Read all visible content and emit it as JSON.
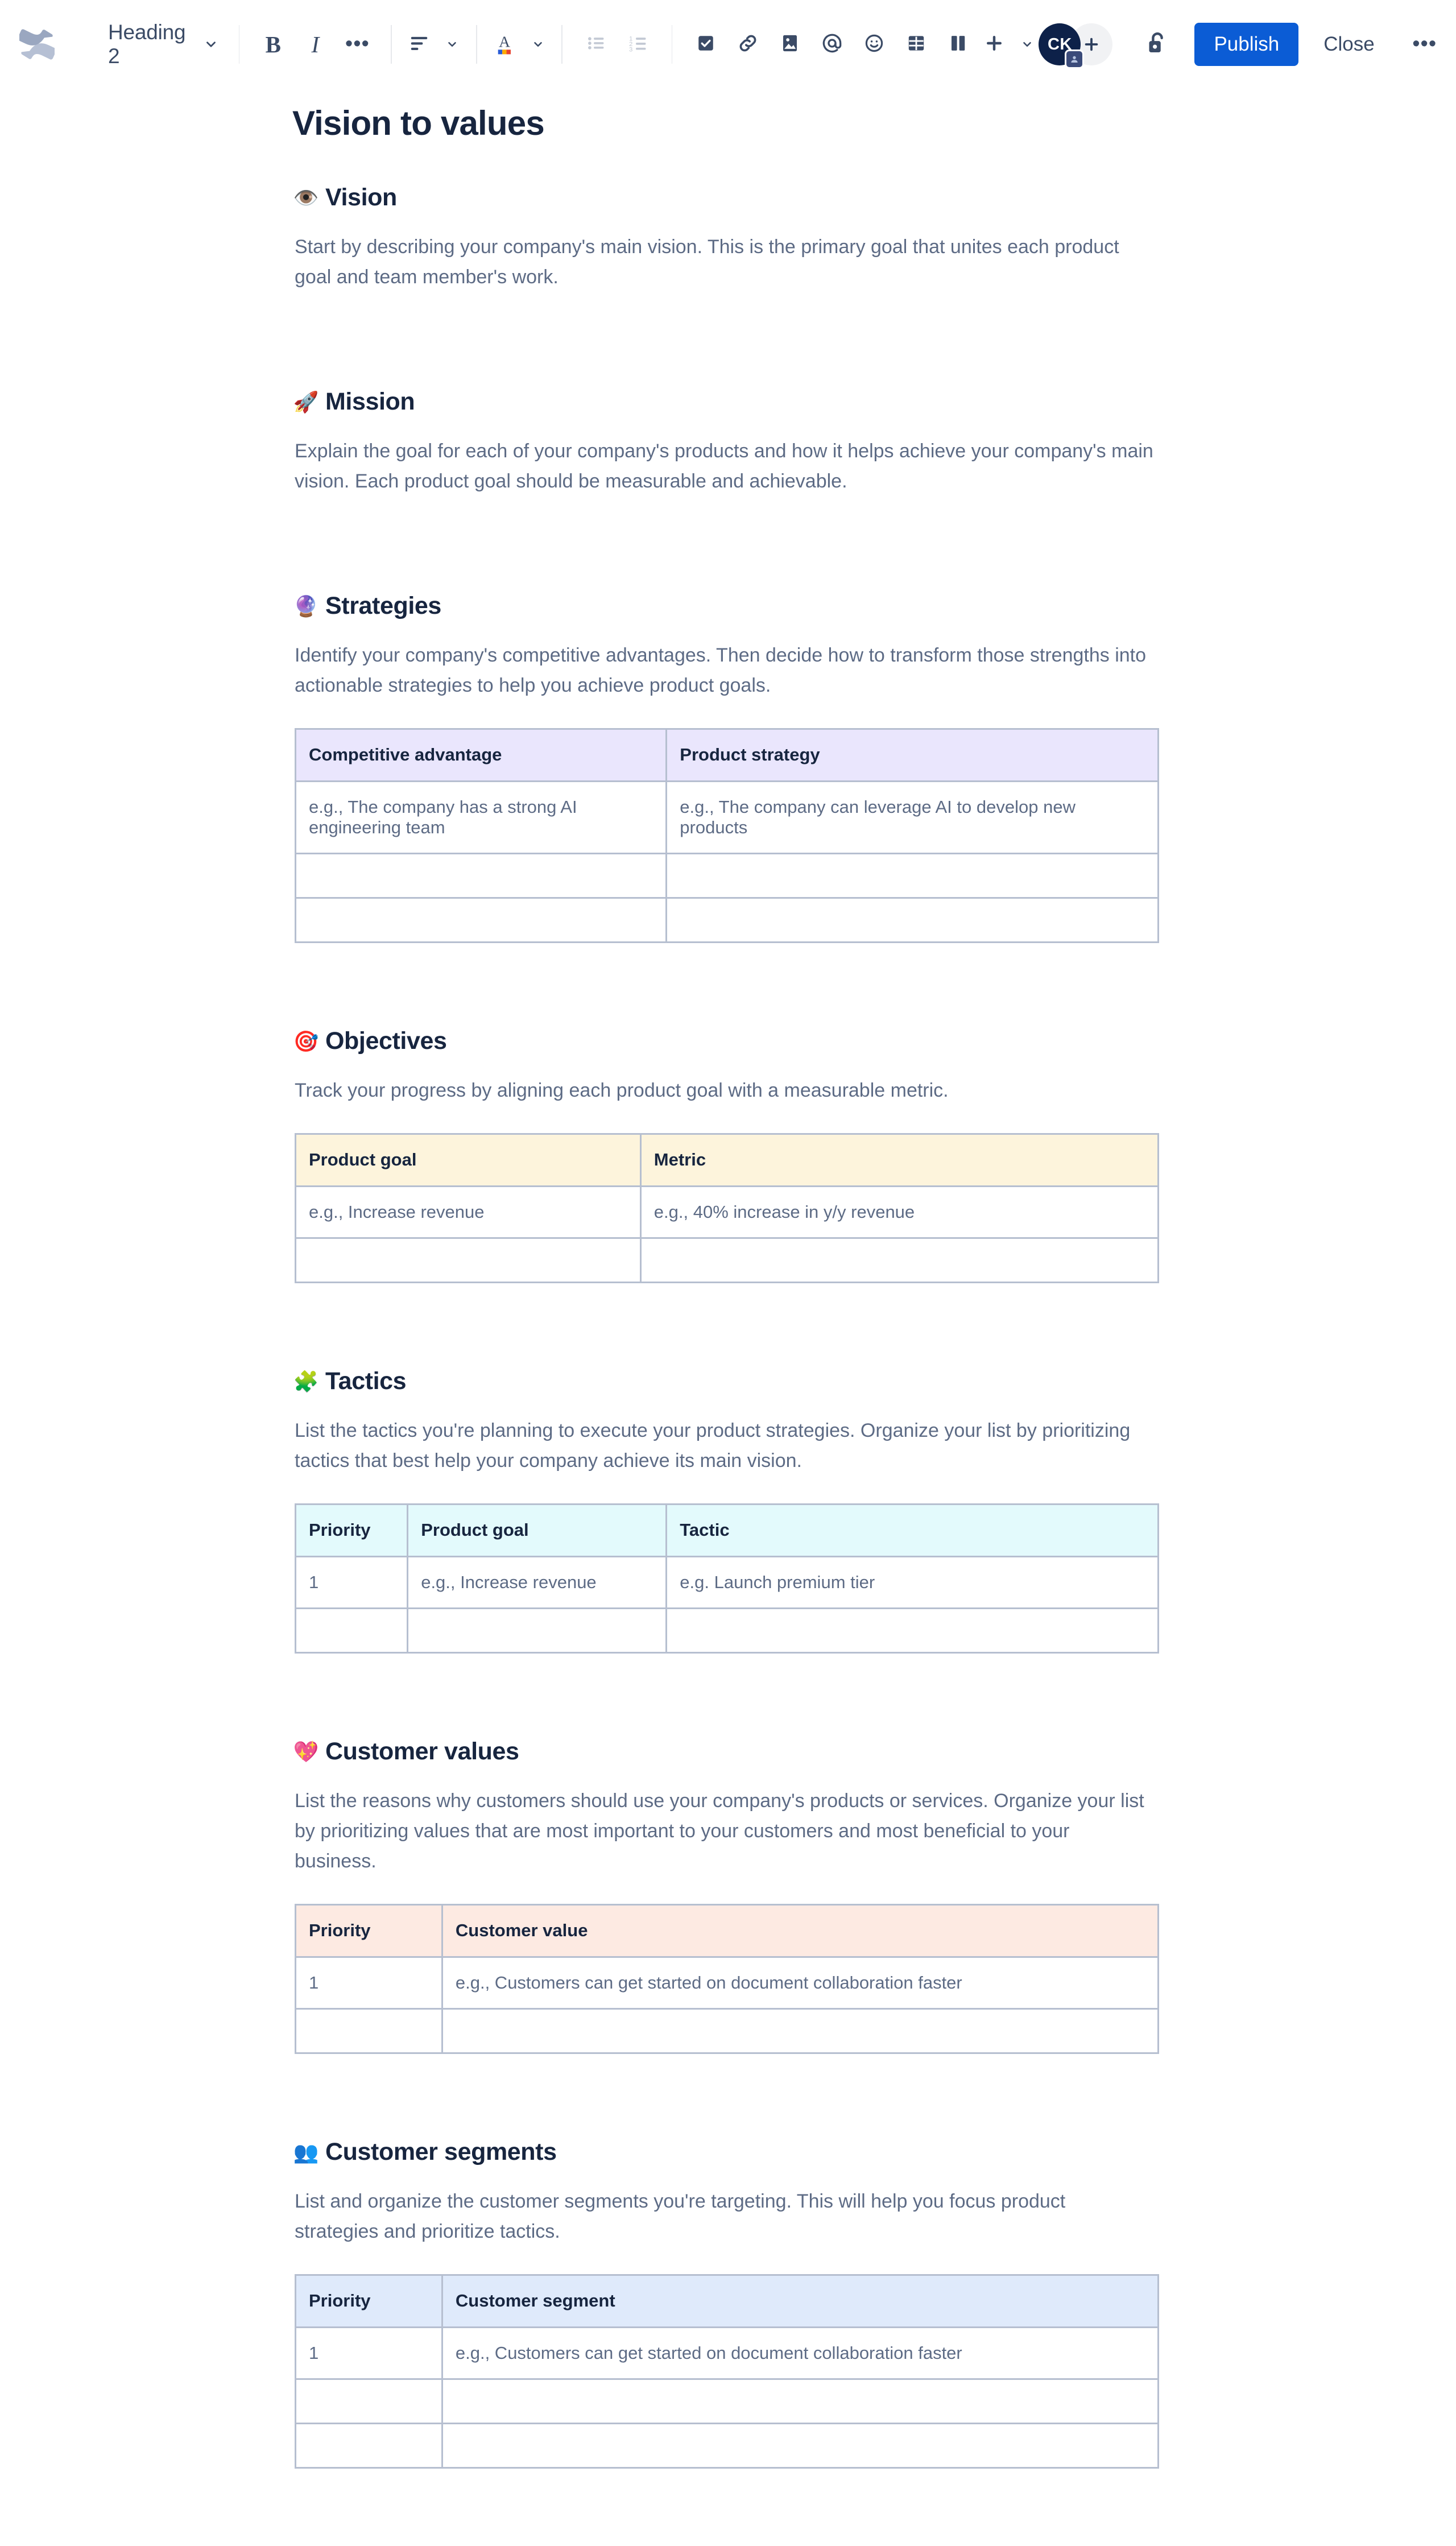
{
  "toolbar": {
    "logo_icon": "confluence-logo-icon",
    "style_select": {
      "label": "Heading 2",
      "icon": "chevron-down-icon"
    },
    "buttons": [
      {
        "name": "bold-button",
        "label": "B",
        "icon": "bold-icon"
      },
      {
        "name": "italic-button",
        "label": "I",
        "icon": "italic-icon"
      },
      {
        "name": "more-text-formatting-button",
        "label": "•••",
        "icon": "ellipsis-icon"
      },
      {
        "name": "text-alignment-button",
        "icon": "align-left-icon"
      },
      {
        "name": "text-color-button",
        "icon": "text-color-icon"
      },
      {
        "name": "bullet-list-button",
        "icon": "bullet-list-icon"
      },
      {
        "name": "numbered-list-button",
        "icon": "numbered-list-icon"
      },
      {
        "name": "action-item-button",
        "icon": "checkbox-icon"
      },
      {
        "name": "link-button",
        "icon": "link-icon"
      },
      {
        "name": "image-button",
        "icon": "image-icon"
      },
      {
        "name": "mention-button",
        "icon": "mention-at-icon"
      },
      {
        "name": "emoji-button",
        "icon": "emoji-smiley-icon"
      },
      {
        "name": "table-button",
        "icon": "table-icon"
      },
      {
        "name": "layout-button",
        "icon": "columns-layout-icon"
      },
      {
        "name": "insert-more-button",
        "icon": "plus-icon"
      }
    ],
    "avatar": {
      "initials": "CK",
      "badge_icon": "presence-badge-icon"
    },
    "add_people_label": "+",
    "lock_icon": "unlock-icon",
    "publish_label": "Publish",
    "close_label": "Close",
    "more_label": "•••"
  },
  "document": {
    "title": "Vision to values",
    "sections": [
      {
        "emoji": "👁️",
        "emoji_name": "eye-emoji",
        "heading": "Vision",
        "body": "Start by describing your company's main vision. This is the primary goal that unites each product goal and team member's work.",
        "table": null
      },
      {
        "emoji": "🚀",
        "emoji_name": "rocket-emoji",
        "heading": "Mission",
        "body": "Explain the goal for each of your company's products and how it helps achieve your company's main vision. Each product goal should be measurable and achievable.",
        "table": null
      },
      {
        "emoji": "🔮",
        "emoji_name": "crystal-ball-emoji",
        "heading": "Strategies",
        "body": "Identify your company's competitive advantages. Then decide how to transform those strengths into actionable strategies to help you achieve product goals.",
        "table": {
          "header_bg": "#eae6fd",
          "columns": [
            {
              "label": "Competitive advantage",
              "width": "43%"
            },
            {
              "label": "Product strategy",
              "width": "57%"
            }
          ],
          "rows": [
            [
              "e.g., The company has a strong AI engineering team",
              "e.g., The company can leverage AI to develop new products"
            ],
            [
              "",
              ""
            ],
            [
              "",
              ""
            ]
          ]
        }
      },
      {
        "emoji": "🎯",
        "emoji_name": "direct-hit-target-emoji",
        "heading": "Objectives",
        "body": "Track your progress by aligning each product goal with a measurable metric.",
        "table": {
          "header_bg": "#fdf4dc",
          "columns": [
            {
              "label": "Product goal",
              "width": "40%"
            },
            {
              "label": "Metric",
              "width": "60%"
            }
          ],
          "rows": [
            [
              "e.g., Increase revenue",
              "e.g., 40% increase in y/y revenue"
            ],
            [
              "",
              ""
            ]
          ]
        }
      },
      {
        "emoji": "🧩",
        "emoji_name": "puzzle-piece-emoji",
        "heading": "Tactics",
        "body": "List the tactics you're planning to execute your product strategies. Organize your list by prioritizing tactics that best help your company achieve its main vision.",
        "table": {
          "header_bg": "#e3fafc",
          "columns": [
            {
              "label": "Priority",
              "width": "13%"
            },
            {
              "label": "Product goal",
              "width": "30%"
            },
            {
              "label": "Tactic",
              "width": "57%"
            }
          ],
          "rows": [
            [
              "1",
              "e.g., Increase revenue",
              "e.g. Launch premium tier"
            ],
            [
              "",
              "",
              ""
            ]
          ]
        }
      },
      {
        "emoji": "💖",
        "emoji_name": "sparkling-heart-emoji",
        "heading": "Customer values",
        "body": "List the reasons why customers should use your company's products or services. Organize your list by prioritizing values that are most important to your customers and most beneficial to your business.",
        "table": {
          "header_bg": "#fdeae2",
          "columns": [
            {
              "label": "Priority",
              "width": "17%"
            },
            {
              "label": "Customer value",
              "width": "83%"
            }
          ],
          "rows": [
            [
              "1",
              "e.g., Customers can get started on document collaboration faster"
            ],
            [
              "",
              ""
            ]
          ]
        }
      },
      {
        "emoji": "👥",
        "emoji_name": "busts-in-silhouette-emoji",
        "heading": "Customer segments",
        "body": "List and organize the customer segments you're targeting. This will help you focus product strategies and prioritize tactics.",
        "table": {
          "header_bg": "#dfeafb",
          "columns": [
            {
              "label": "Priority",
              "width": "17%"
            },
            {
              "label": "Customer segment",
              "width": "83%"
            }
          ],
          "rows": [
            [
              "1",
              "e.g., Customers can get started on document collaboration faster"
            ],
            [
              "",
              ""
            ],
            [
              "",
              ""
            ]
          ]
        }
      }
    ]
  },
  "colors": {
    "accent_publish": "#0b5cd5",
    "heading_text": "#17253f",
    "body_text": "#5d6b85",
    "table_border": "#b6bfd0"
  }
}
